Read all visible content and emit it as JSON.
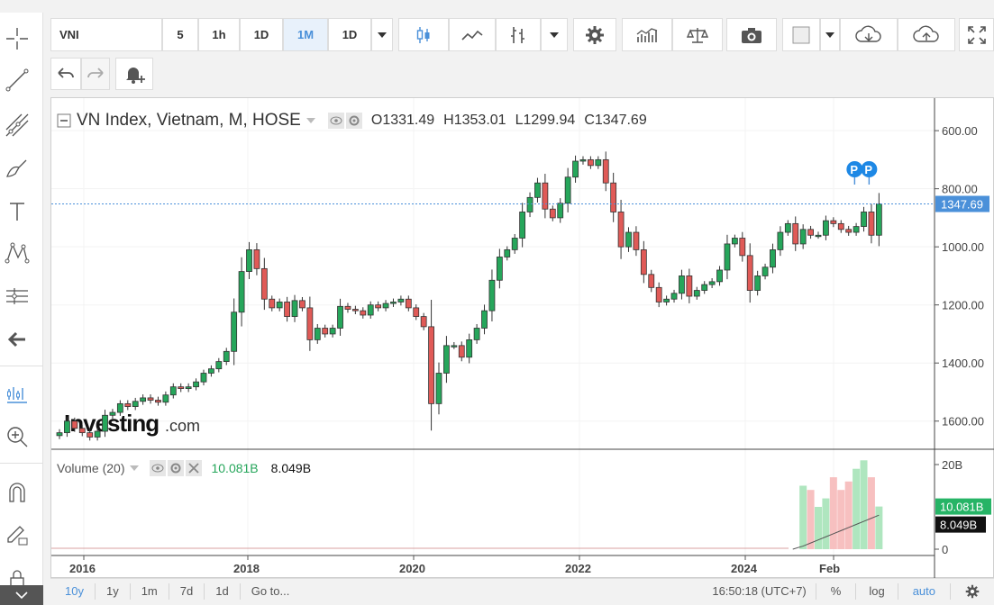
{
  "toolbar": {
    "symbol": "VNI",
    "intervals": [
      "5",
      "1h",
      "1D",
      "1M"
    ],
    "active_interval": "1M",
    "range_select": "1D"
  },
  "legend": {
    "title": "VN Index, Vietnam, M, HOSE",
    "open_label": "O",
    "open": "1331.49",
    "high_label": "H",
    "high": "1353.01",
    "low_label": "L",
    "low": "1299.94",
    "close_label": "C",
    "close": "1347.69"
  },
  "price_axis": {
    "ticks": [
      "1600.00",
      "1400.00",
      "1200.00",
      "1000.00",
      "800.00",
      "600.00"
    ],
    "last_price_label": "1347.69"
  },
  "volume": {
    "title": "Volume (20)",
    "value": "10.081B",
    "ma_value": "8.049B",
    "ticks": [
      "20B",
      "0"
    ],
    "current_label": "10.081B",
    "ma_label": "8.049B"
  },
  "time_axis": [
    "2016",
    "2018",
    "2020",
    "2022",
    "2024",
    "Feb"
  ],
  "watermark": "Investing",
  "watermark_suffix": ".com",
  "markers": [
    "P",
    "P"
  ],
  "bottom_bar": {
    "ranges": [
      "10y",
      "1y",
      "1m",
      "7d",
      "1d"
    ],
    "active_range": "10y",
    "goto": "Go to...",
    "time": "16:50:18 (UTC+7)",
    "percent": "%",
    "log": "log",
    "auto": "auto"
  },
  "colors": {
    "up": "#26a65b",
    "down": "#e05a57",
    "accent": "#4a90d9",
    "volume_up": "#a6e3b8",
    "volume_down": "#f6b9b9"
  },
  "chart_data": {
    "type": "candlestick",
    "title": "VN Index, Vietnam, M, HOSE",
    "x_start": "2015-12",
    "x_labels": [
      "2016",
      "2018",
      "2020",
      "2022",
      "2024",
      "Feb"
    ],
    "ylim": [
      500,
      1650
    ],
    "y_ticks": [
      600,
      800,
      1000,
      1200,
      1400,
      1600
    ],
    "closes": [
      560,
      600,
      575,
      560,
      545,
      565,
      620,
      630,
      660,
      650,
      668,
      680,
      672,
      665,
      690,
      718,
      712,
      718,
      735,
      765,
      780,
      805,
      840,
      975,
      1115,
      1190,
      1125,
      1020,
      990,
      1010,
      960,
      1015,
      990,
      880,
      920,
      900,
      920,
      995,
      985,
      980,
      965,
      1000,
      990,
      1005,
      1010,
      1020,
      990,
      960,
      925,
      660,
      765,
      860,
      860,
      820,
      880,
      920,
      980,
      1085,
      1165,
      1190,
      1230,
      1320,
      1370,
      1420,
      1330,
      1300,
      1350,
      1440,
      1495,
      1500,
      1480,
      1500,
      1420,
      1320,
      1200,
      1250,
      1190,
      1105,
      1060,
      1010,
      1020,
      1040,
      1100,
      1030,
      1050,
      1070,
      1080,
      1120,
      1210,
      1230,
      1170,
      1050,
      1100,
      1130,
      1190,
      1250,
      1280,
      1210,
      1260,
      1240,
      1240,
      1290,
      1280,
      1260,
      1250,
      1270,
      1320,
      1240,
      1347.69
    ],
    "volume": {
      "scale_max": 20,
      "unit": "B",
      "recent_values": [
        15,
        14,
        10,
        12,
        17,
        14,
        16,
        19,
        21,
        17,
        10.081
      ],
      "ma": 8.049
    }
  }
}
